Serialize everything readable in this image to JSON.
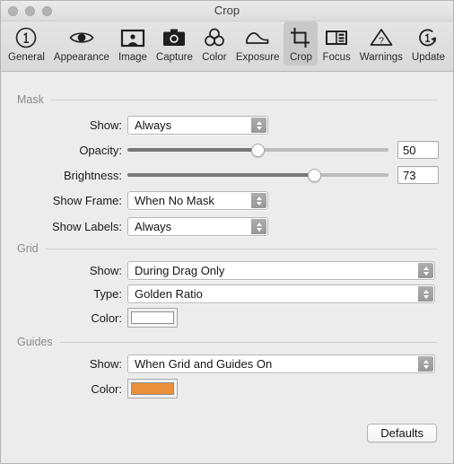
{
  "window": {
    "title": "Crop",
    "traffic_lights": [
      "close-button",
      "minimize-button",
      "zoom-button"
    ]
  },
  "toolbar": {
    "items": [
      {
        "label": "General",
        "icon": "numbered-circle-one-icon",
        "selected": false
      },
      {
        "label": "Appearance",
        "icon": "eye-icon",
        "selected": false
      },
      {
        "label": "Image",
        "icon": "framed-portrait-icon",
        "selected": false
      },
      {
        "label": "Capture",
        "icon": "camera-icon",
        "selected": false
      },
      {
        "label": "Color",
        "icon": "three-circles-icon",
        "selected": false
      },
      {
        "label": "Exposure",
        "icon": "mountain-curve-icon",
        "selected": false
      },
      {
        "label": "Crop",
        "icon": "crop-icon",
        "selected": true
      },
      {
        "label": "Focus",
        "icon": "focus-grid-icon",
        "selected": false
      },
      {
        "label": "Warnings",
        "icon": "warning-triangle-icon",
        "selected": false
      },
      {
        "label": "Update",
        "icon": "refresh-one-icon",
        "selected": false
      }
    ]
  },
  "sections": {
    "mask": {
      "title": "Mask",
      "show": {
        "label": "Show:",
        "value": "Always"
      },
      "opacity": {
        "label": "Opacity:",
        "value": "50",
        "percent": 50
      },
      "brightness": {
        "label": "Brightness:",
        "value": "73",
        "percent": 73
      },
      "show_frame": {
        "label": "Show Frame:",
        "value": "When No Mask"
      },
      "show_labels": {
        "label": "Show Labels:",
        "value": "Always"
      }
    },
    "grid": {
      "title": "Grid",
      "show": {
        "label": "Show:",
        "value": "During Drag Only"
      },
      "type": {
        "label": "Type:",
        "value": "Golden Ratio"
      },
      "color": {
        "label": "Color:",
        "value": "#ffffff"
      }
    },
    "guides": {
      "title": "Guides",
      "show": {
        "label": "Show:",
        "value": "When Grid and Guides On"
      },
      "color": {
        "label": "Color:",
        "value": "#ea8f3a"
      }
    }
  },
  "footer": {
    "defaults_label": "Defaults"
  }
}
